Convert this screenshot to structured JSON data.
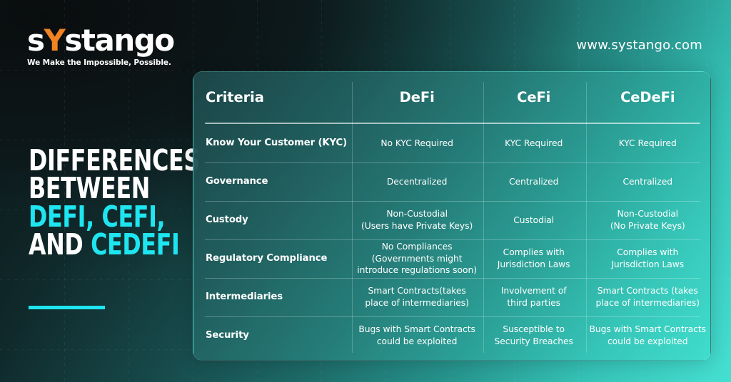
{
  "brand": {
    "logo_text_pre": "s",
    "logo_text_y": "Y",
    "logo_text_post": "stango",
    "tagline": "We Make the Impossible, Possible.",
    "website": "www.systango.com",
    "accent_orange": "#F08222",
    "accent_cyan": "#1EE5F0"
  },
  "headline": {
    "line1": "DIFFERENCES",
    "line2": "BETWEEN",
    "line3_accent": "DEFI, CEFI,",
    "line4_plain": "AND ",
    "line4_accent": "CEDEFI"
  },
  "table": {
    "headers": {
      "criteria": "Criteria",
      "defi": "DeFi",
      "cefi": "CeFi",
      "cedefi": "CeDeFi"
    },
    "rows": [
      {
        "criteria": "Know Your Customer (KYC)",
        "defi": "No KYC Required",
        "cefi": "KYC Required",
        "cedefi": "KYC Required"
      },
      {
        "criteria": "Governance",
        "defi": "Decentralized",
        "cefi": "Centralized",
        "cedefi": "Centralized"
      },
      {
        "criteria": "Custody",
        "defi": "Non-Custodial\n(Users have Private Keys)",
        "cefi": "Custodial",
        "cedefi": "Non-Custodial\n(No Private Keys)"
      },
      {
        "criteria": "Regulatory Compliance",
        "defi": "No Compliances\n(Governments might\nintroduce regulations soon)",
        "cefi": "Complies with\nJurisdiction Laws",
        "cedefi": "Complies with\nJurisdiction Laws"
      },
      {
        "criteria": "Intermediaries",
        "defi": "Smart Contracts(takes\nplace of intermediaries)",
        "cefi": "Involvement of\nthird parties",
        "cedefi": "Smart Contracts (takes\nplace of intermediaries)"
      },
      {
        "criteria": "Security",
        "defi": "Bugs with Smart Contracts\ncould be exploited",
        "cefi": "Susceptible to\nSecurity Breaches",
        "cedefi": "Bugs with Smart Contracts\ncould be exploited"
      }
    ]
  }
}
